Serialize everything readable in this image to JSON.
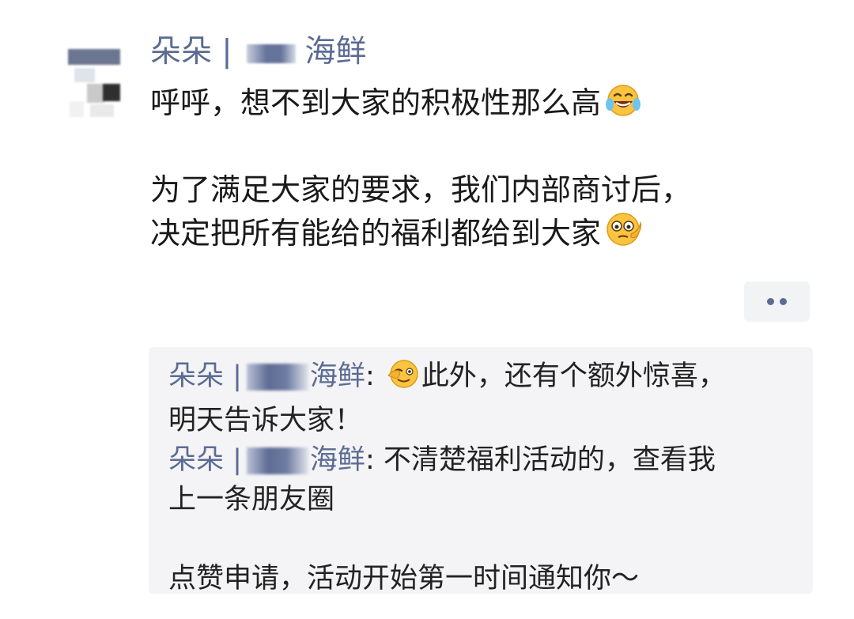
{
  "post": {
    "author_prefix": "朵朵 |",
    "author_suffix": "海鲜",
    "line1": "呼呼，想不到大家的积极性那么高",
    "line1_emoji": "laughing-tears-emoji",
    "line2": "为了满足大家的要求，我们内部商讨后，",
    "line3": "决定把所有能给的福利都给到大家",
    "line3_emoji": "thinking-emoji"
  },
  "actions": {
    "more_icon": "more-dots-icon"
  },
  "comments": [
    {
      "author_prefix": "朵朵 |",
      "author_suffix": "海鲜",
      "separator": ": ",
      "emoji": "wink-emoji",
      "line1": "此外，还有个额外惊喜，",
      "line2": "明天告诉大家！"
    },
    {
      "author_prefix": "朵朵 |",
      "author_suffix": "海鲜",
      "separator": ": ",
      "line1": "不清楚福利活动的，查看我",
      "line2": "上一条朋友圈",
      "line3": "点赞申请，活动开始第一时间通知你～"
    }
  ],
  "colors": {
    "name_link": "#5b6b93",
    "comment_bg": "#f4f4f6",
    "text": "#1a1a1a"
  }
}
